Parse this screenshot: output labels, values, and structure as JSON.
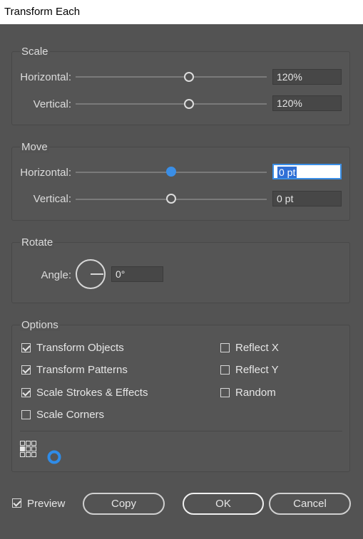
{
  "window": {
    "title": "Transform Each"
  },
  "scale": {
    "label": "Scale",
    "horizontal": {
      "label": "Horizontal:",
      "value": "120%",
      "slider_fraction": 0.6
    },
    "vertical": {
      "label": "Vertical:",
      "value": "120%",
      "slider_fraction": 0.6
    }
  },
  "move": {
    "label": "Move",
    "horizontal": {
      "label": "Horizontal:",
      "value": "0 pt",
      "slider_fraction": 0.5
    },
    "vertical": {
      "label": "Vertical:",
      "value": "0 pt",
      "slider_fraction": 0.5
    }
  },
  "rotate": {
    "label": "Rotate",
    "angle_label": "Angle:",
    "angle_value": "0°"
  },
  "options": {
    "label": "Options",
    "transform_objects": {
      "label": "Transform Objects",
      "checked": true
    },
    "transform_patterns": {
      "label": "Transform Patterns",
      "checked": true
    },
    "scale_strokes": {
      "label": "Scale Strokes & Effects",
      "checked": true
    },
    "scale_corners": {
      "label": "Scale Corners",
      "checked": false
    },
    "reflect_x": {
      "label": "Reflect X",
      "checked": false
    },
    "reflect_y": {
      "label": "Reflect Y",
      "checked": false
    },
    "random": {
      "label": "Random",
      "checked": false
    }
  },
  "footer": {
    "preview": {
      "label": "Preview",
      "checked": true
    },
    "copy_label": "Copy",
    "ok_label": "OK",
    "cancel_label": "Cancel"
  },
  "colors": {
    "accent": "#3a8ee6",
    "background": "#535353"
  }
}
